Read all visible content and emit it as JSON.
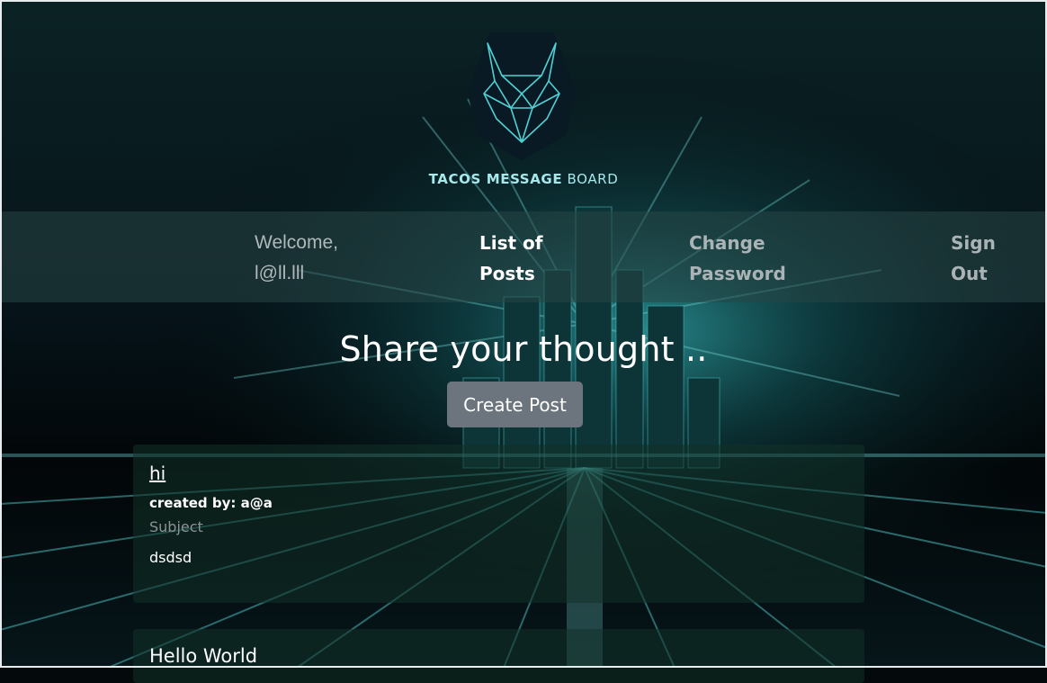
{
  "brand": {
    "name_bold": "TACOS MESSAGE",
    "name_light": " BOARD"
  },
  "nav": {
    "welcome_line1": "Welcome,",
    "welcome_line2": "l@ll.lll",
    "posts_line1": "List of",
    "posts_line2": "Posts",
    "change_line1": "Change",
    "change_line2": "Password",
    "signout_line1": "Sign",
    "signout_line2": "Out"
  },
  "hero": {
    "title": "Share your thought ..",
    "create_button": "Create Post"
  },
  "posts": [
    {
      "title": "hi",
      "created_by": "created by: a@a",
      "subject_label": "Subject",
      "body": "dsdsd"
    },
    {
      "title": "Hello World"
    }
  ],
  "colors": {
    "accent": "#4fd1d4",
    "button": "#6c757d",
    "navbar": "#284646"
  }
}
